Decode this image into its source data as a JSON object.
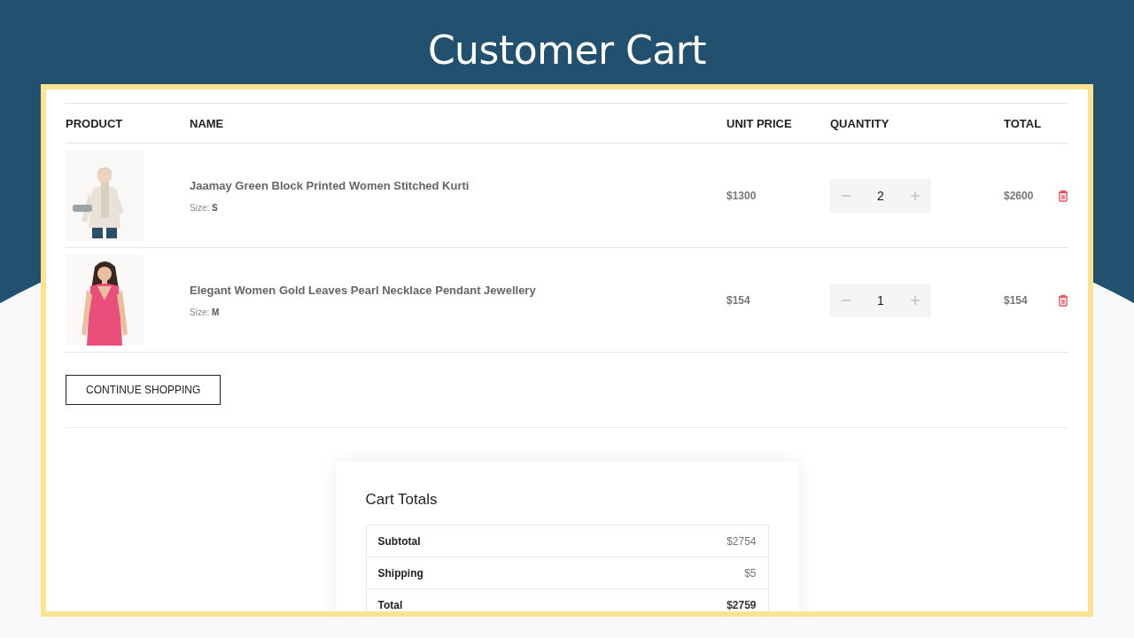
{
  "slide": {
    "title": "Customer Cart"
  },
  "table": {
    "columns": [
      "PRODUCT",
      "NAME",
      "UNIT PRICE",
      "QUANTITY",
      "TOTAL"
    ],
    "rows": [
      {
        "name": "Jaamay Green Block Printed Women Stitched Kurti",
        "size": "Size: **S**",
        "unit_price": "$1300",
        "quantity": "2",
        "total": "$2600"
      },
      {
        "name": "Elegant Women Gold Leaves Pearl Necklace Pendant Jewellery",
        "size": "Size: **M**",
        "unit_price": "$154",
        "quantity": "1",
        "total": "$154"
      }
    ]
  },
  "continue_button": "CONTINUE SHOPPING",
  "cart_totals": {
    "title": "Cart Totals",
    "rows": [
      {
        "label": "Subtotal",
        "value": "$2754",
        "kind": "plain"
      },
      {
        "label": "Shipping",
        "value": "$5",
        "kind": "plain"
      },
      {
        "label": "Total",
        "value": "$2759",
        "kind": "grand"
      }
    ]
  }
}
